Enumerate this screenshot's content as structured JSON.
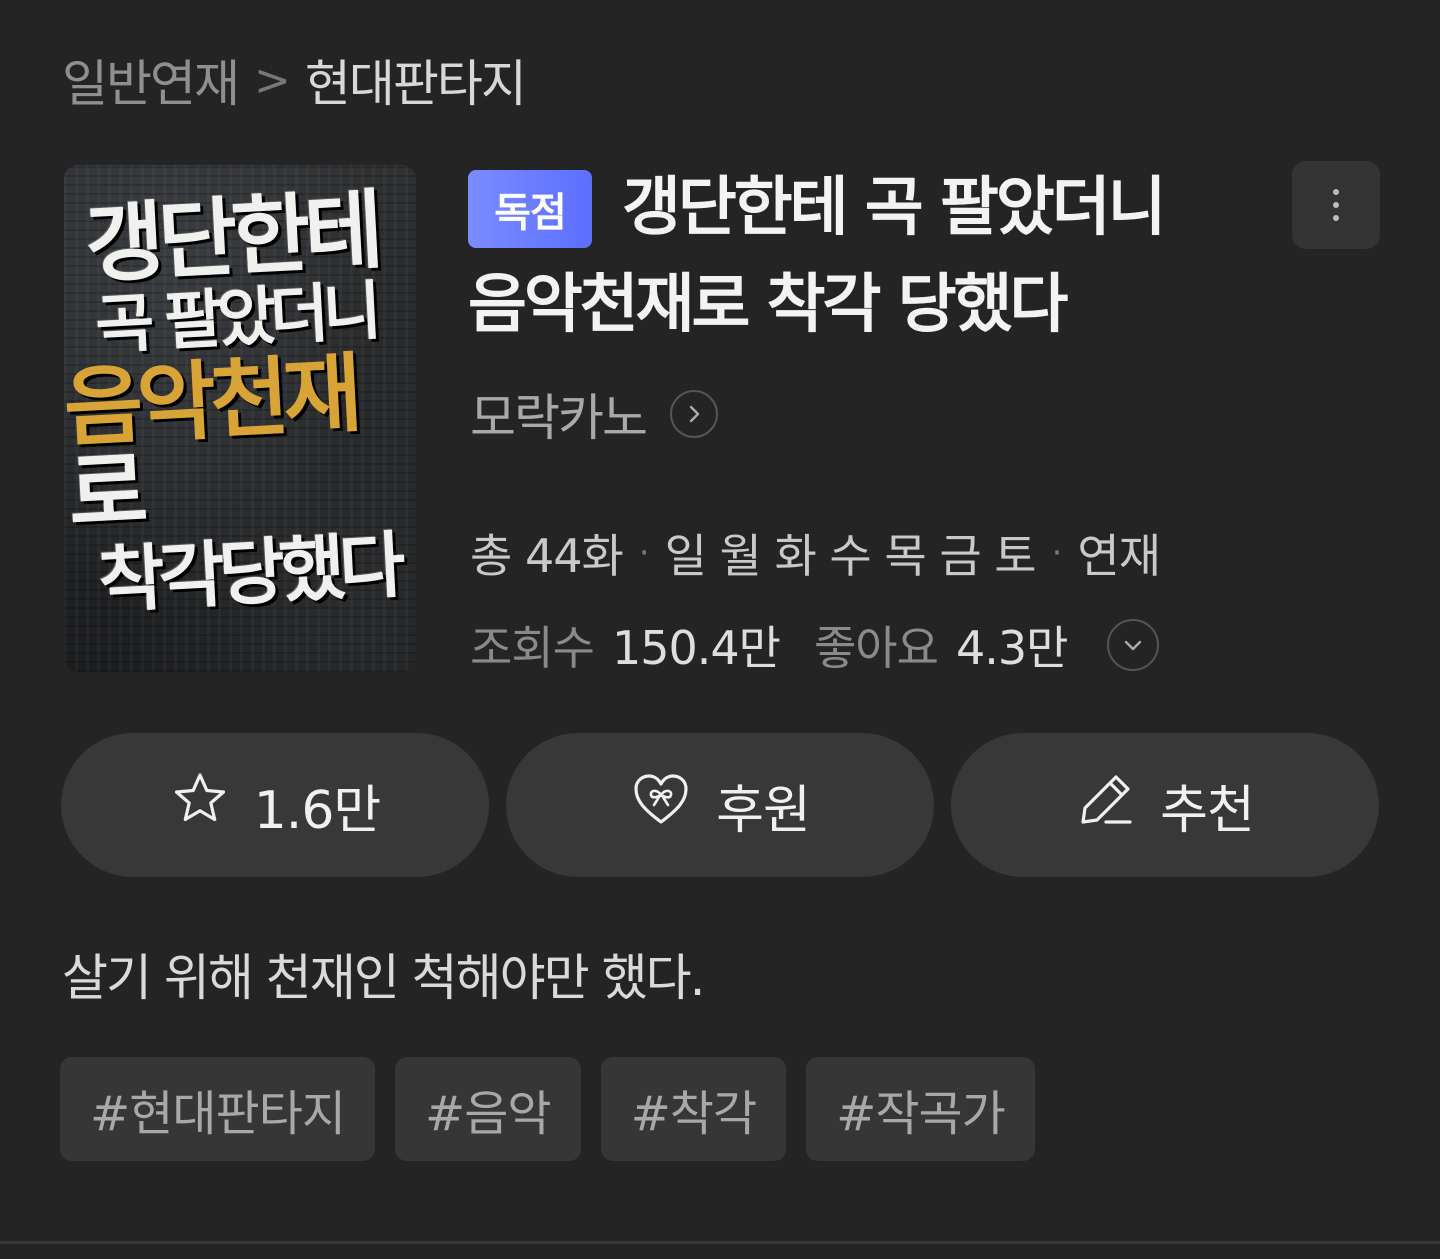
{
  "breadcrumb": {
    "category": "일반연재",
    "separator": ">",
    "genre": "현대판타지"
  },
  "cover": {
    "line1": "갱단한테",
    "line2": "곡 팔았더니",
    "line3_gold": "음악천재",
    "line3_rest": "로",
    "line4": "착각당했다"
  },
  "badge": "독점",
  "title": "갱단한테 곡 팔았더니 음악천재로 착각 당했다",
  "author": "모락카노",
  "info": {
    "episodes": "총 44화",
    "days": "일 월 화 수 목 금 토",
    "status": "연재",
    "views_label": "조회수",
    "views_value": "150.4만",
    "likes_label": "좋아요",
    "likes_value": "4.3만"
  },
  "actions": {
    "favorite_count": "1.6만",
    "support_label": "후원",
    "recommend_label": "추천"
  },
  "synopsis": "살기 위해 천재인 척해야만 했다.",
  "tags": [
    "#현대판타지",
    "#음악",
    "#착각",
    "#작곡가"
  ],
  "icons": {
    "more": "more-vertical-icon",
    "author_arrow": "chevron-right-icon",
    "expand": "chevron-down-icon",
    "favorite": "star-icon",
    "support": "heart-gift-icon",
    "recommend": "pencil-icon"
  },
  "colors": {
    "background": "#242424",
    "badge_start": "#7b8cff",
    "badge_end": "#5b6fff",
    "button": "#383838",
    "tag": "#363636"
  }
}
